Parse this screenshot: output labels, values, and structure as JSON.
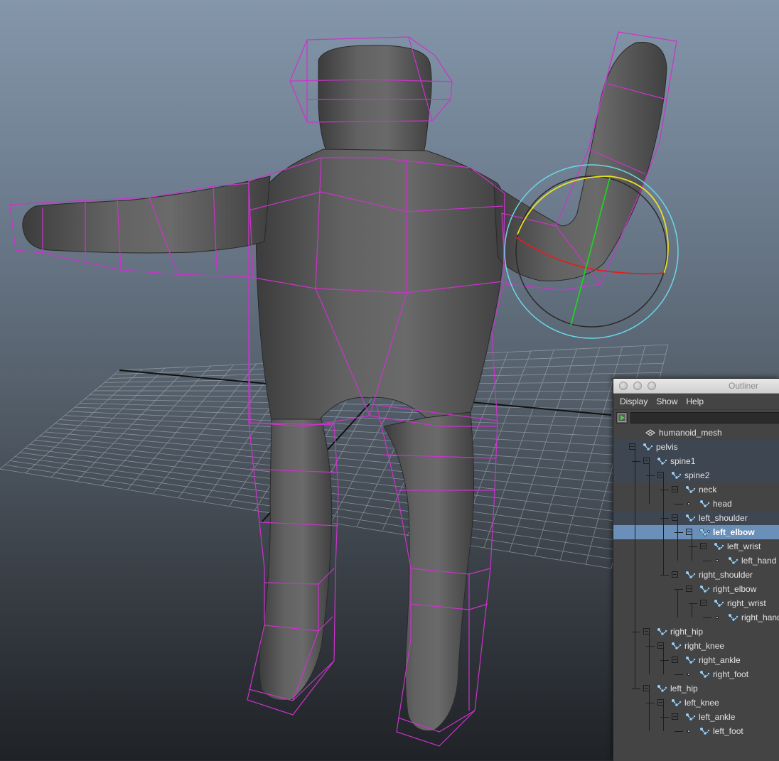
{
  "outliner": {
    "title": "Outliner",
    "menus": [
      "Display",
      "Show",
      "Help"
    ],
    "filter": {
      "value": "",
      "placeholder": ""
    },
    "nodes": [
      {
        "label": "humanoid_mesh",
        "depth": 0,
        "type": "mesh",
        "expander": "none"
      },
      {
        "label": "pelvis",
        "depth": 0,
        "type": "joint",
        "expander": "minus"
      },
      {
        "label": "spine1",
        "depth": 1,
        "type": "joint",
        "expander": "minus"
      },
      {
        "label": "spine2",
        "depth": 2,
        "type": "joint",
        "expander": "minus"
      },
      {
        "label": "neck",
        "depth": 3,
        "type": "joint",
        "expander": "minus"
      },
      {
        "label": "head",
        "depth": 4,
        "type": "joint",
        "expander": "dot"
      },
      {
        "label": "left_shoulder",
        "depth": 3,
        "type": "joint",
        "expander": "minus"
      },
      {
        "label": "left_elbow",
        "depth": 4,
        "type": "joint",
        "expander": "minus",
        "selected": true
      },
      {
        "label": "left_wrist",
        "depth": 5,
        "type": "joint",
        "expander": "minus"
      },
      {
        "label": "left_hand",
        "depth": 6,
        "type": "joint",
        "expander": "dot"
      },
      {
        "label": "right_shoulder",
        "depth": 3,
        "type": "joint",
        "expander": "minus"
      },
      {
        "label": "right_elbow",
        "depth": 4,
        "type": "joint",
        "expander": "minus"
      },
      {
        "label": "right_wrist",
        "depth": 5,
        "type": "joint",
        "expander": "minus"
      },
      {
        "label": "right_hand",
        "depth": 6,
        "type": "joint",
        "expander": "dot"
      },
      {
        "label": "right_hip",
        "depth": 1,
        "type": "joint",
        "expander": "minus"
      },
      {
        "label": "right_knee",
        "depth": 2,
        "type": "joint",
        "expander": "minus"
      },
      {
        "label": "right_ankle",
        "depth": 3,
        "type": "joint",
        "expander": "minus"
      },
      {
        "label": "right_foot",
        "depth": 4,
        "type": "joint",
        "expander": "dot"
      },
      {
        "label": "left_hip",
        "depth": 1,
        "type": "joint",
        "expander": "minus"
      },
      {
        "label": "left_knee",
        "depth": 2,
        "type": "joint",
        "expander": "minus"
      },
      {
        "label": "left_ankle",
        "depth": 3,
        "type": "joint",
        "expander": "minus"
      },
      {
        "label": "left_foot",
        "depth": 4,
        "type": "joint",
        "expander": "dot"
      }
    ]
  },
  "colors": {
    "wireframe": "#cc33cc",
    "mesh": "#5e5e5e",
    "selection_row": "#6a8fb8",
    "rotate_outer": "#6ad8e8",
    "rotate_x": "#e02020",
    "rotate_y": "#20d020",
    "rotate_z": "#e8e020"
  }
}
